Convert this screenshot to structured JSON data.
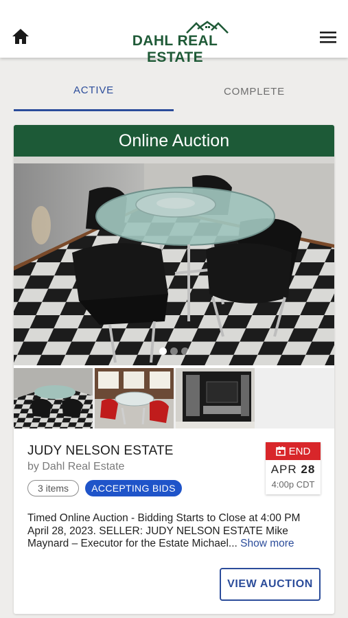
{
  "header": {
    "logo_text": "DAHL REAL ESTATE",
    "brand_color": "#1f5a37",
    "home_icon": "home-icon",
    "menu_icon": "hamburger-menu-icon"
  },
  "tabs": [
    {
      "label": "ACTIVE",
      "selected": true
    },
    {
      "label": "COMPLETE",
      "selected": false
    }
  ],
  "listing": {
    "banner": "Online Auction",
    "banner_color": "#1d5a37",
    "image_count_dots": 3,
    "active_dot": 1,
    "thumbnail_count": 3,
    "title": "JUDY NELSON ESTATE",
    "byline": "by Dahl Real Estate",
    "items_badge": "3 items",
    "status_badge": "ACCEPTING BIDS",
    "status_color": "#1f54c9",
    "end_label": "END",
    "end_color": "#d8262a",
    "end_month": "APR",
    "end_day": "28",
    "end_time": "4:00p CDT",
    "description": "Timed Online Auction - Bidding Starts to Close at 4:00 PM April 28, 2023. SELLER: JUDY NELSON ESTATE Mike Maynard – Executor for the Estate Michael...",
    "show_more": "Show more",
    "view_button": "VIEW AUCTION"
  }
}
